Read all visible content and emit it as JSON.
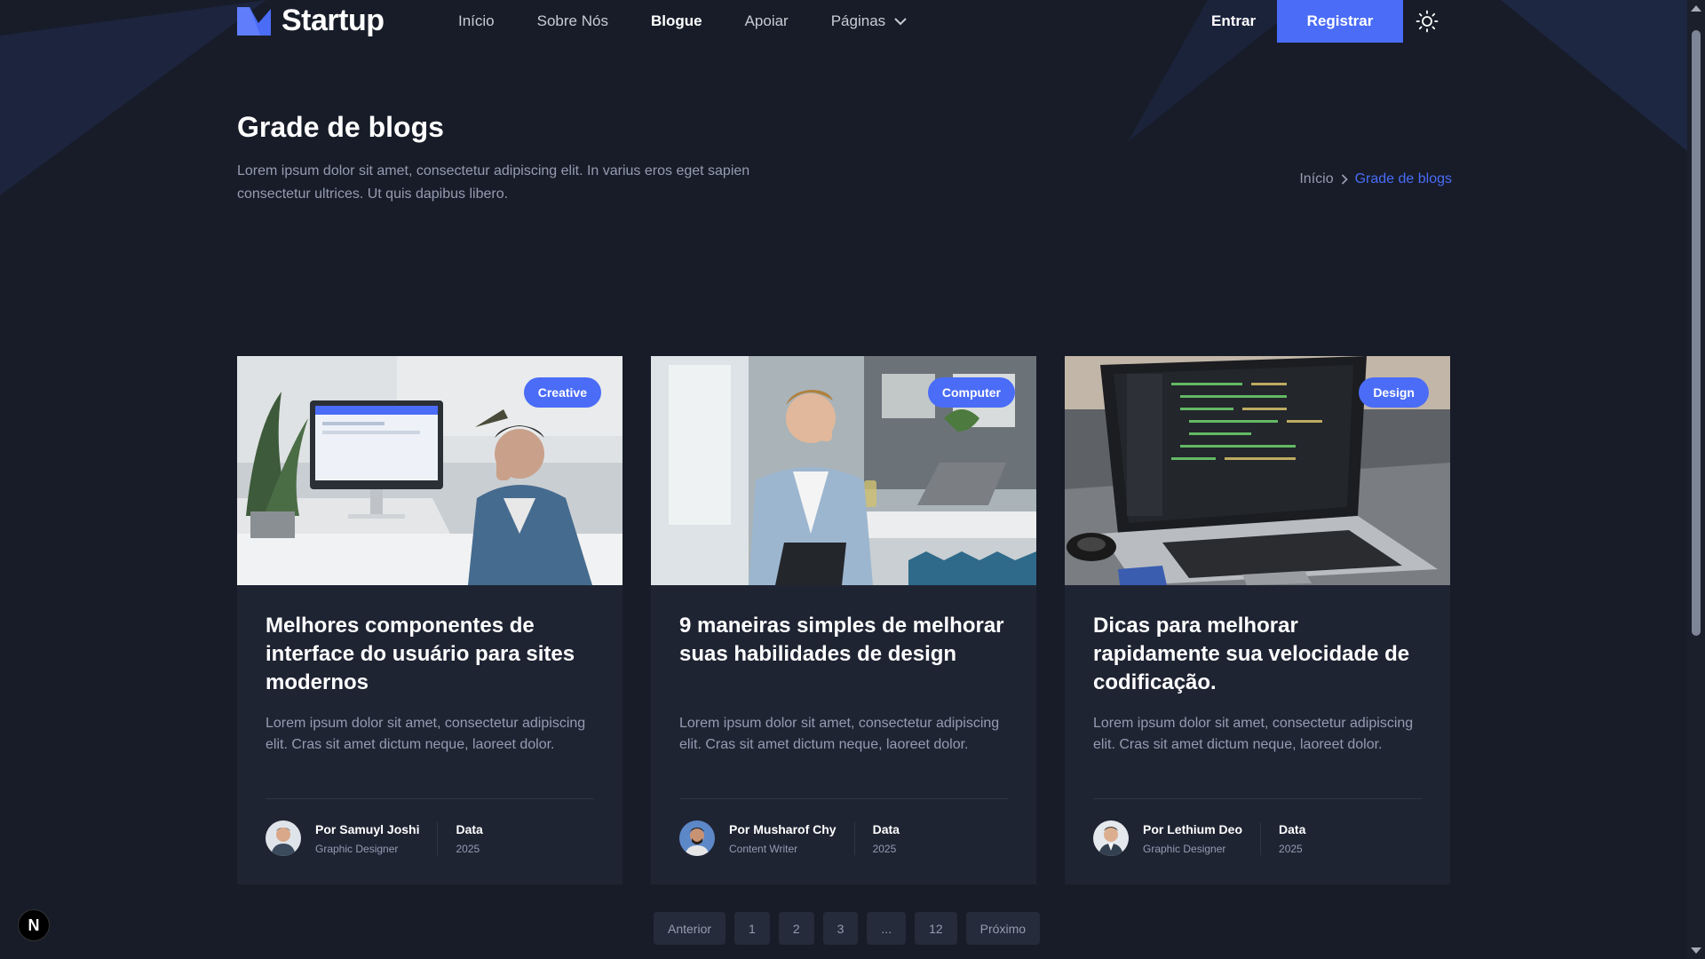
{
  "header": {
    "logo_text": "Startup",
    "nav": [
      {
        "label": "Início"
      },
      {
        "label": "Sobre Nós"
      },
      {
        "label": "Blogue"
      },
      {
        "label": "Apoiar"
      },
      {
        "label": "Páginas"
      }
    ],
    "signin_label": "Entrar",
    "signup_label": "Registrar"
  },
  "hero": {
    "title": "Grade de blogs",
    "description": "Lorem ipsum dolor sit amet, consectetur adipiscing elit. In varius eros eget sapien consectetur ultrices. Ut quis dapibus libero.",
    "breadcrumb_home": "Início",
    "breadcrumb_current": "Grade de blogs"
  },
  "cards": [
    {
      "tag": "Creative",
      "title": "Melhores componentes de interface do usuário para sites modernos",
      "text": "Lorem ipsum dolor sit amet, consectetur adipiscing elit. Cras sit amet dictum neque, laoreet dolor.",
      "author": "Por Samuyl Joshi",
      "role": "Graphic Designer",
      "date_label": "Data",
      "date_value": "2025"
    },
    {
      "tag": "Computer",
      "title": "9 maneiras simples de melhorar suas habilidades de design",
      "text": "Lorem ipsum dolor sit amet, consectetur adipiscing elit. Cras sit amet dictum neque, laoreet dolor.",
      "author": "Por Musharof Chy",
      "role": "Content Writer",
      "date_label": "Data",
      "date_value": "2025"
    },
    {
      "tag": "Design",
      "title": "Dicas para melhorar rapidamente sua velocidade de codificação.",
      "text": "Lorem ipsum dolor sit amet, consectetur adipiscing elit. Cras sit amet dictum neque, laoreet dolor.",
      "author": "Por Lethium Deo",
      "role": "Graphic Designer",
      "date_label": "Data",
      "date_value": "2025"
    }
  ],
  "pagination": {
    "prev": "Anterior",
    "pages": [
      "1",
      "2",
      "3",
      "...",
      "12"
    ],
    "next": "Próximo"
  },
  "next_badge": "N",
  "colors": {
    "background": "#171c28",
    "card": "#1f2433",
    "primary": "#4a6cf7",
    "muted_text": "#959cb1"
  }
}
